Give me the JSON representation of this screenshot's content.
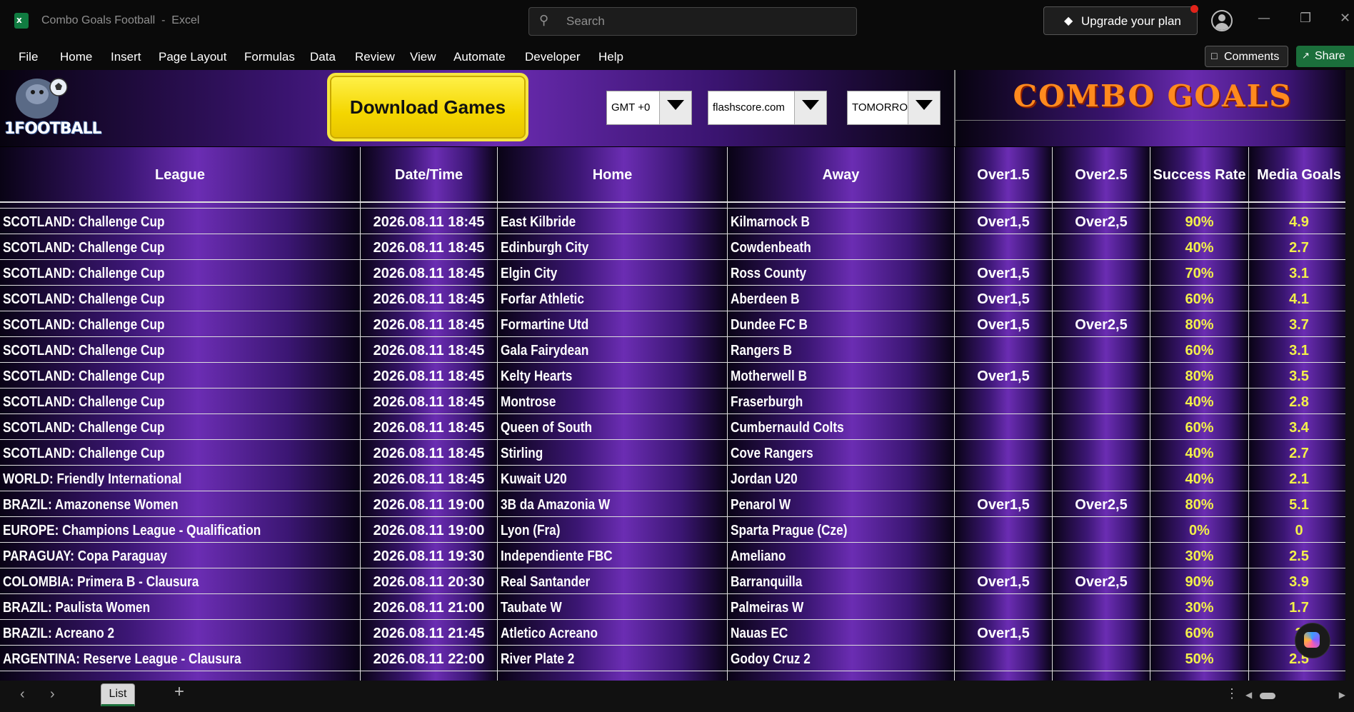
{
  "window": {
    "doc_title": "Combo Goals Football",
    "app_name": "Excel",
    "search_placeholder": "Search",
    "upgrade_label": "Upgrade your plan",
    "minimize": "—",
    "restore": "❐",
    "close": "✕"
  },
  "ribbon": {
    "menus": [
      "File",
      "Home",
      "Insert",
      "Page Layout",
      "Formulas",
      "Data",
      "Review",
      "View",
      "Automate",
      "Developer",
      "Help"
    ],
    "comments_label": "Comments",
    "share_label": "Share"
  },
  "header_panel": {
    "logo_text": "1FOOTBALL",
    "download_label": "Download Games",
    "timezone": "GMT +0",
    "source": "flashscore.com",
    "day": "TOMORRO",
    "brand_title": "COMBO GOALS"
  },
  "table": {
    "columns": [
      "League",
      "Date/Time",
      "Home",
      "Away",
      "Over1.5",
      "Over2.5",
      "Success Rate",
      "Media Goals"
    ],
    "rows": [
      [
        "SCOTLAND: Challenge Cup",
        "2026.08.11 18:45",
        "East Kilbride",
        "Kilmarnock B",
        "Over1,5",
        "Over2,5",
        "90%",
        "4.9"
      ],
      [
        "SCOTLAND: Challenge Cup",
        "2026.08.11 18:45",
        "Edinburgh City",
        "Cowdenbeath",
        "",
        "",
        "40%",
        "2.7"
      ],
      [
        "SCOTLAND: Challenge Cup",
        "2026.08.11 18:45",
        "Elgin City",
        "Ross County",
        "Over1,5",
        "",
        "70%",
        "3.1"
      ],
      [
        "SCOTLAND: Challenge Cup",
        "2026.08.11 18:45",
        "Forfar Athletic",
        "Aberdeen B",
        "Over1,5",
        "",
        "60%",
        "4.1"
      ],
      [
        "SCOTLAND: Challenge Cup",
        "2026.08.11 18:45",
        "Formartine Utd",
        "Dundee FC B",
        "Over1,5",
        "Over2,5",
        "80%",
        "3.7"
      ],
      [
        "SCOTLAND: Challenge Cup",
        "2026.08.11 18:45",
        "Gala Fairydean",
        "Rangers B",
        "",
        "",
        "60%",
        "3.1"
      ],
      [
        "SCOTLAND: Challenge Cup",
        "2026.08.11 18:45",
        "Kelty Hearts",
        "Motherwell B",
        "Over1,5",
        "",
        "80%",
        "3.5"
      ],
      [
        "SCOTLAND: Challenge Cup",
        "2026.08.11 18:45",
        "Montrose",
        "Fraserburgh",
        "",
        "",
        "40%",
        "2.8"
      ],
      [
        "SCOTLAND: Challenge Cup",
        "2026.08.11 18:45",
        "Queen of South",
        "Cumbernauld Colts",
        "",
        "",
        "60%",
        "3.4"
      ],
      [
        "SCOTLAND: Challenge Cup",
        "2026.08.11 18:45",
        "Stirling",
        "Cove Rangers",
        "",
        "",
        "40%",
        "2.7"
      ],
      [
        "WORLD: Friendly International",
        "2026.08.11 18:45",
        "Kuwait U20",
        "Jordan U20",
        "",
        "",
        "40%",
        "2.1"
      ],
      [
        "BRAZIL: Amazonense Women",
        "2026.08.11 19:00",
        "3B da Amazonia W",
        "Penarol W",
        "Over1,5",
        "Over2,5",
        "80%",
        "5.1"
      ],
      [
        "EUROPE: Champions League - Qualification",
        "2026.08.11 19:00",
        "Lyon (Fra)",
        "Sparta Prague (Cze)",
        "",
        "",
        "0%",
        "0"
      ],
      [
        "PARAGUAY: Copa Paraguay",
        "2026.08.11 19:30",
        "Independiente FBC",
        "Ameliano",
        "",
        "",
        "30%",
        "2.5"
      ],
      [
        "COLOMBIA: Primera B - Clausura",
        "2026.08.11 20:30",
        "Real Santander",
        "Barranquilla",
        "Over1,5",
        "Over2,5",
        "90%",
        "3.9"
      ],
      [
        "BRAZIL: Paulista Women",
        "2026.08.11 21:00",
        "Taubate W",
        "Palmeiras W",
        "",
        "",
        "30%",
        "1.7"
      ],
      [
        "BRAZIL: Acreano 2",
        "2026.08.11 21:45",
        "Atletico Acreano",
        "Nauas EC",
        "Over1,5",
        "",
        "60%",
        "3"
      ],
      [
        "ARGENTINA: Reserve League - Clausura",
        "2026.08.11 22:00",
        "River Plate 2",
        "Godoy Cruz 2",
        "",
        "",
        "50%",
        "2.5"
      ]
    ]
  },
  "sheet_tabs": {
    "active": "List",
    "add_icon": "+",
    "more_icon": "⋮"
  }
}
